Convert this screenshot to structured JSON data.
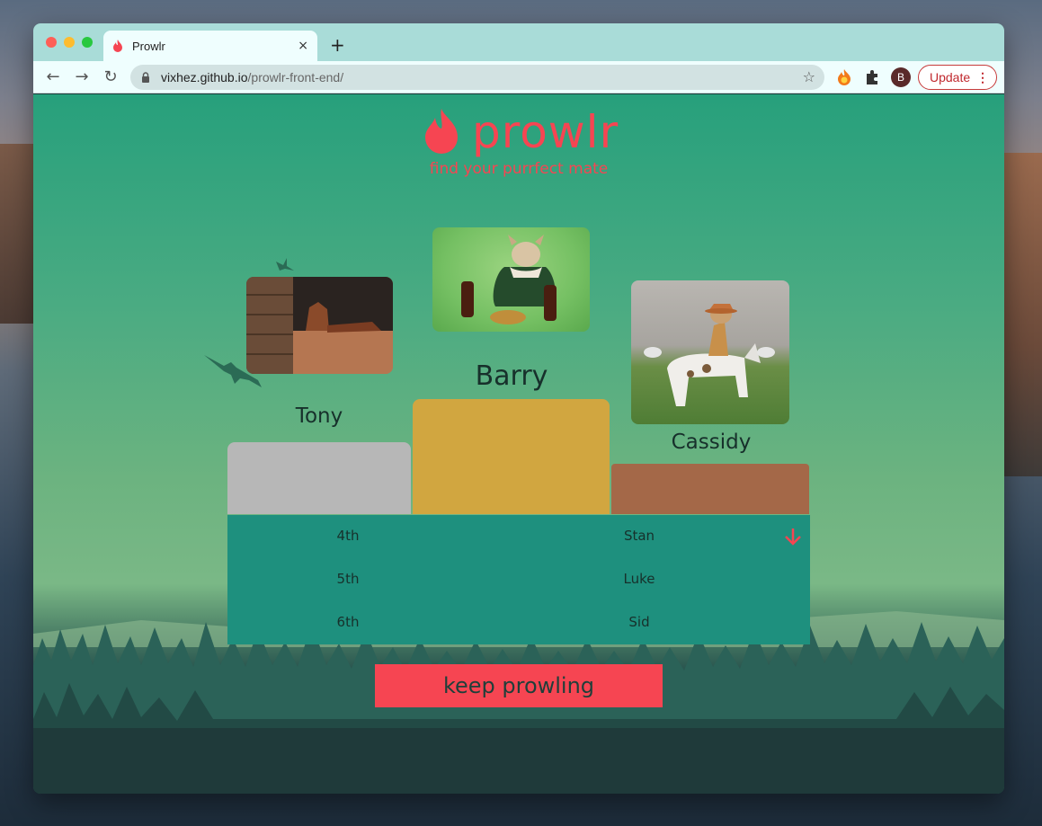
{
  "browser": {
    "tab_title": "Prowlr",
    "new_tab": "+",
    "tab_close": "×",
    "url_host": "vixhez.github.io",
    "url_path": "/prowlr-front-end/",
    "avatar_initial": "B",
    "update_label": "Update",
    "update_menu": "⋮"
  },
  "header": {
    "logo_text": "prowlr",
    "tagline": "find your purrfect mate"
  },
  "podium": {
    "first": "Barry",
    "second": "Tony",
    "third": "Cassidy"
  },
  "rankings": [
    {
      "position": "4th",
      "name": "Stan"
    },
    {
      "position": "5th",
      "name": "Luke"
    },
    {
      "position": "6th",
      "name": "Sid"
    }
  ],
  "actions": {
    "keep_prowling": "keep prowling"
  },
  "colors": {
    "brand": "#f64552",
    "gold": "#d1a640",
    "silver": "#b7b7b7",
    "bronze": "#a46848",
    "teal": "#1e907e"
  }
}
